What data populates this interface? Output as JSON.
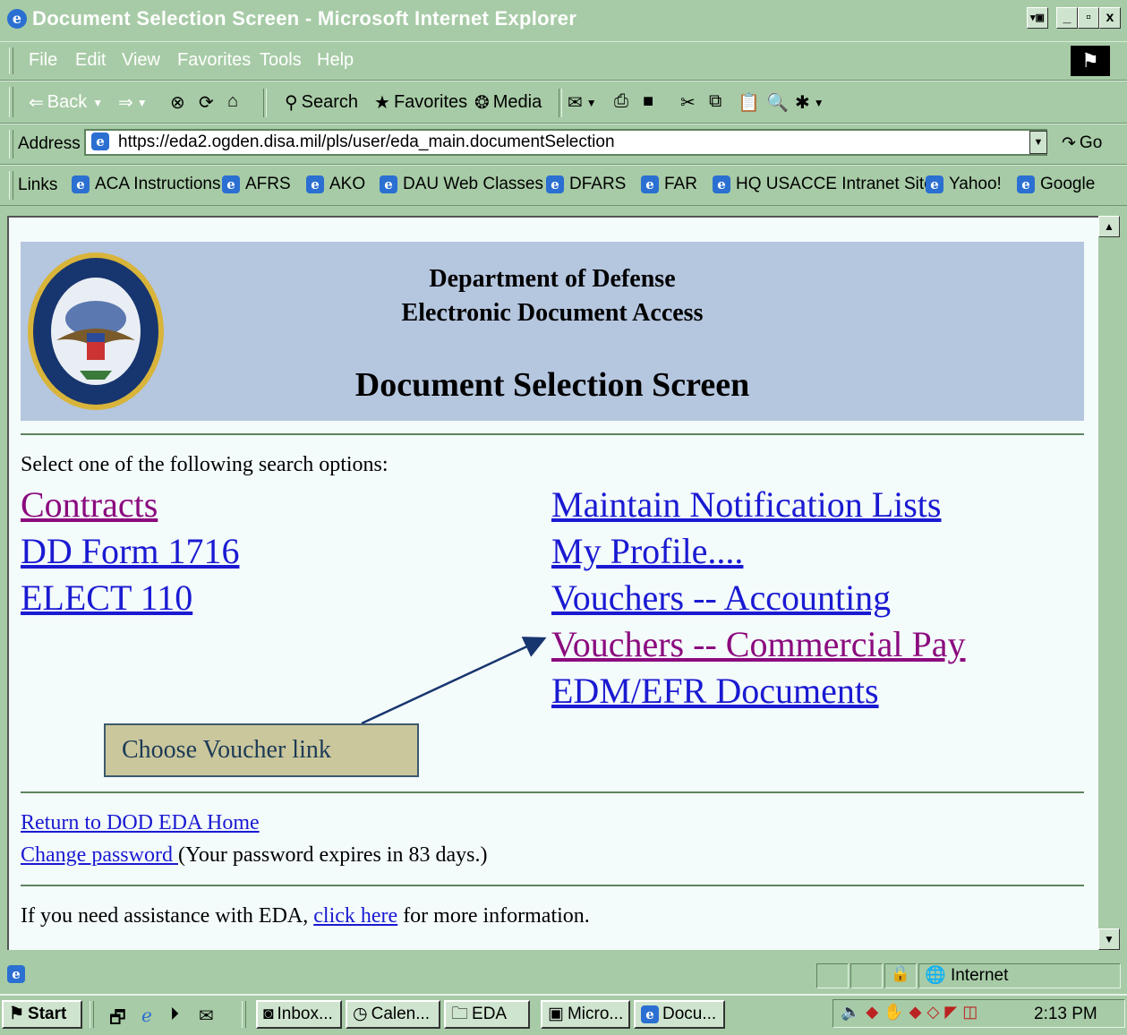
{
  "window": {
    "title": "Document Selection Screen - Microsoft Internet Explorer",
    "buttons": {
      "minimize": "_",
      "maximize": "▫",
      "close": "x"
    }
  },
  "menubar": [
    "File",
    "Edit",
    "View",
    "Favorites",
    "Tools",
    "Help"
  ],
  "toolbar": {
    "back": "Back",
    "search": "Search",
    "favorites": "Favorites",
    "media": "Media"
  },
  "address": {
    "label": "Address",
    "url": "https://eda2.ogden.disa.mil/pls/user/eda_main.documentSelection",
    "go": "Go"
  },
  "links_bar": {
    "label": "Links",
    "items": [
      "ACA Instructions",
      "AFRS",
      "AKO",
      "DAU Web Classes",
      "DFARS",
      "FAR",
      "HQ USACCE Intranet Site",
      "Yahoo!",
      "Google"
    ]
  },
  "page": {
    "header_line1": "Department of Defense",
    "header_line2": "Electronic Document Access",
    "header_title": "Document Selection Screen",
    "prompt": "Select one of the following search options:",
    "left_links": [
      "Contracts",
      "DD Form 1716",
      "ELECT 110"
    ],
    "right_links": [
      "Maintain Notification Lists",
      "My Profile....",
      "Vouchers -- Accounting",
      "Vouchers -- Commercial Pay",
      "EDM/EFR Documents"
    ],
    "callout": "Choose Voucher link",
    "return_link": "Return to DOD EDA Home",
    "change_password_link": "Change password ",
    "password_note": "(Your password expires in 83 days.)",
    "assist_prefix": "If you need assistance with EDA, ",
    "assist_link": "click here",
    "assist_suffix": " for more information."
  },
  "statusbar": {
    "zone": "Internet"
  },
  "taskbar": {
    "start": "Start",
    "tasks": [
      "Inbox...",
      "Calen...",
      "EDA",
      "Micro...",
      "Docu..."
    ],
    "clock": "2:13 PM"
  },
  "colors": {
    "chrome": "#a7cba6",
    "header_band": "#b5c6df",
    "link_blue": "#1a1ad2",
    "visited_purple": "#8b0a7e",
    "callout_bg": "#cbc79d"
  }
}
